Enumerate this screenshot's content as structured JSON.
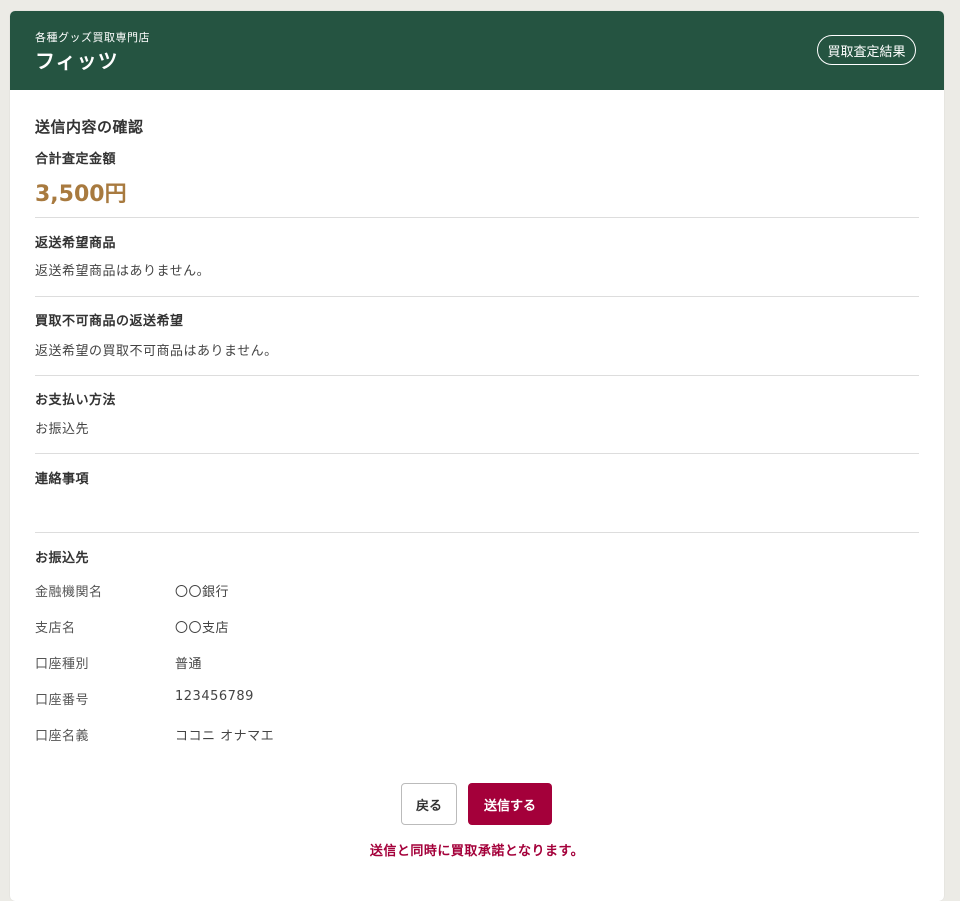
{
  "header": {
    "subtitle": "各種グッズ買取専門店",
    "store_name": "フィッツ",
    "result_button": "買取査定結果"
  },
  "page_title": "送信内容の確認",
  "total": {
    "label": "合計査定金額",
    "value": "3,500円"
  },
  "sections": {
    "return_items": {
      "heading": "返送希望商品",
      "text": "返送希望商品はありません。"
    },
    "unpurchasable_return": {
      "heading": "買取不可商品の返送希望",
      "text": "返送希望の買取不可商品はありません。"
    },
    "payment_method": {
      "heading": "お支払い方法",
      "text": "お振込先"
    },
    "contact_notes": {
      "heading": "連絡事項",
      "text": ""
    },
    "bank_transfer": {
      "heading": "お振込先",
      "rows": [
        {
          "label": "金融機関名",
          "value": "〇〇銀行"
        },
        {
          "label": "支店名",
          "value": "〇〇支店"
        },
        {
          "label": "口座種別",
          "value": "普通"
        },
        {
          "label": "口座番号",
          "value": "123456789"
        },
        {
          "label": "口座名義",
          "value": "ココニ オナマエ"
        }
      ]
    }
  },
  "actions": {
    "back_label": "戻る",
    "submit_label": "送信する",
    "notice": "送信と同時に買取承諾となります。"
  },
  "colors": {
    "header_bg": "#255441",
    "price": "#a87a3f",
    "submit_bg": "#a4003a",
    "page_bg": "#ecebe6"
  }
}
